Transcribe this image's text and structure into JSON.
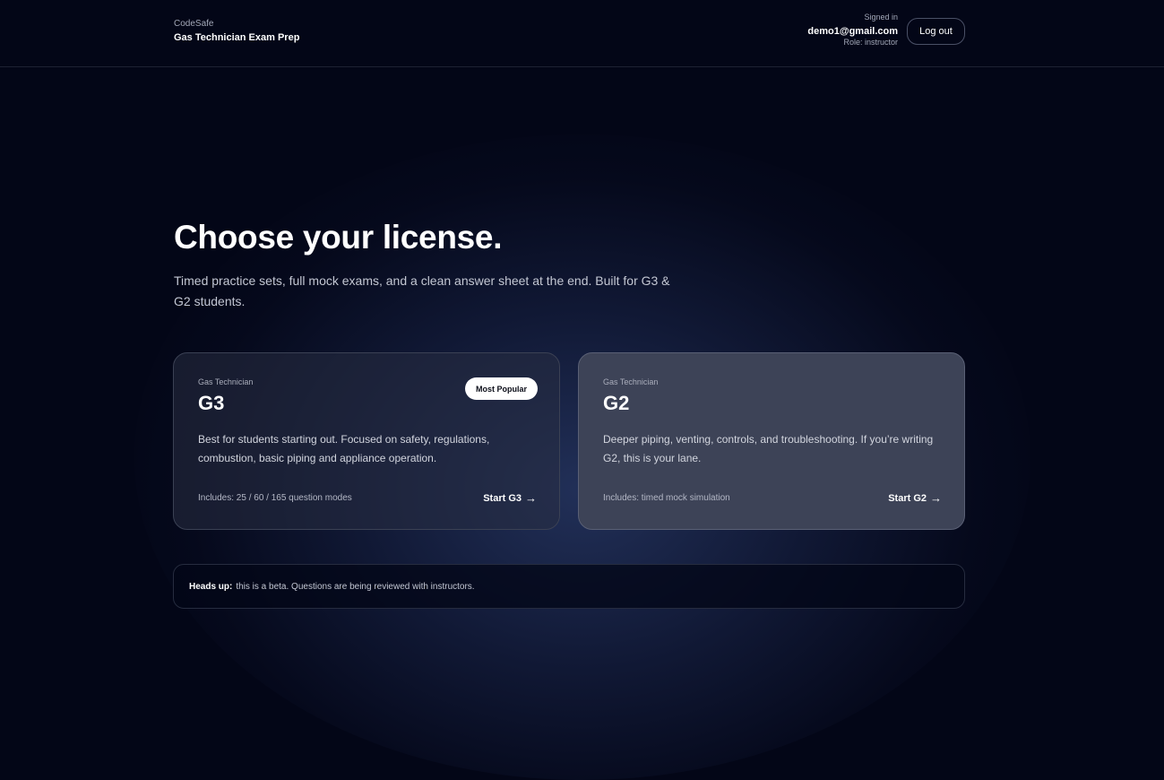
{
  "header": {
    "brand_name": "CodeSafe",
    "product_name": "Gas Technician Exam Prep",
    "signed_in_label": "Signed in",
    "user_email": "demo1@gmail.com",
    "user_role": "Role: instructor",
    "logout_label": "Log out"
  },
  "hero": {
    "title": "Choose your license.",
    "subtitle": "Timed practice sets, full mock exams, and a clean answer sheet at the end. Built for G3 & G2 students."
  },
  "cards": [
    {
      "kicker": "Gas Technician",
      "title": "G3",
      "badge": "Most Popular",
      "description": "Best for students starting out. Focused on safety, regulations, combustion, basic piping and appliance operation.",
      "includes": "Includes: 25 / 60 / 165 question modes",
      "start_label": "Start G3",
      "arrow": "→"
    },
    {
      "kicker": "Gas Technician",
      "title": "G2",
      "description": "Deeper piping, venting, controls, and troubleshooting. If you’re writing G2, this is your lane.",
      "includes": "Includes: timed mock simulation",
      "start_label": "Start G2",
      "arrow": "→"
    }
  ],
  "notice": {
    "label": "Heads up:",
    "text": "this is a beta. Questions are being reviewed with instructors."
  }
}
